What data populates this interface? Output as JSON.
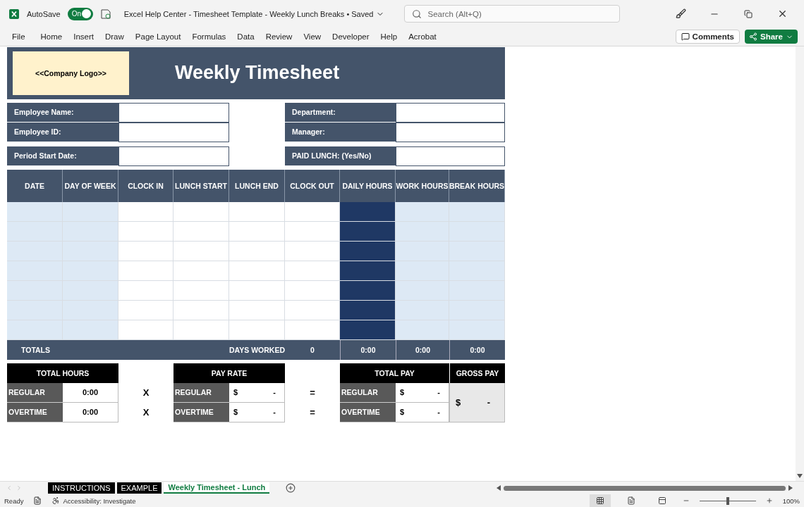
{
  "window": {
    "title": "Excel Help Center - Timesheet Template - Weekly Lunch Breaks • Saved",
    "autosave": {
      "label": "AutoSave",
      "on": true,
      "state_label": "On"
    },
    "search": {
      "placeholder": "Search (Alt+Q)"
    }
  },
  "menu": {
    "items": [
      {
        "label": "File"
      },
      {
        "label": "Home"
      },
      {
        "label": "Insert"
      },
      {
        "label": "Draw"
      },
      {
        "label": "Page Layout"
      },
      {
        "label": "Formulas"
      },
      {
        "label": "Data"
      },
      {
        "label": "Review"
      },
      {
        "label": "View"
      },
      {
        "label": "Developer"
      },
      {
        "label": "Help"
      },
      {
        "label": "Acrobat"
      }
    ],
    "comments": "Comments",
    "share": "Share"
  },
  "sheet": {
    "logo": "<<Company Logo>>",
    "title": "Weekly Timesheet",
    "info_left": [
      {
        "label": "Employee Name:"
      },
      {
        "label": "Employee ID:"
      },
      {
        "label": "Period Start Date:"
      }
    ],
    "info_right": [
      {
        "label": "Department:"
      },
      {
        "label": "Manager:"
      },
      {
        "label": "PAID LUNCH: (Yes/No)"
      }
    ],
    "columns": [
      "DATE",
      "DAY OF WEEK",
      "CLOCK IN",
      "LUNCH START",
      "LUNCH END",
      "CLOCK OUT",
      "DAILY HOURS",
      "WORK HOURS",
      "BREAK HOURS"
    ],
    "totals": {
      "label": "TOTALS",
      "days_worked_label": "DAYS WORKED",
      "days_worked": "0",
      "daily_hours": "0:00",
      "work_hours": "0:00",
      "break_hours": "0:00"
    },
    "total_hours": {
      "title": "TOTAL HOURS",
      "rows": [
        {
          "label": "REGULAR",
          "value": "0:00"
        },
        {
          "label": "OVERTIME",
          "value": "0:00"
        }
      ]
    },
    "operators": [
      "X",
      "X"
    ],
    "pay_rate": {
      "title": "PAY RATE",
      "rows": [
        {
          "label": "REGULAR",
          "currency": "$",
          "value": "-"
        },
        {
          "label": "OVERTIME",
          "currency": "$",
          "value": "-"
        }
      ]
    },
    "equals": [
      "=",
      "="
    ],
    "total_pay": {
      "title": "TOTAL PAY",
      "rows": [
        {
          "label": "REGULAR",
          "currency": "$",
          "value": "-"
        },
        {
          "label": "OVERTIME",
          "currency": "$",
          "value": "-"
        }
      ]
    },
    "gross_pay": {
      "title": "GROSS PAY",
      "currency": "$",
      "value": "-"
    }
  },
  "sheet_tabs": [
    {
      "label": "INSTRUCTIONS",
      "selected": false
    },
    {
      "label": "EXAMPLE",
      "selected": false
    },
    {
      "label": "Weekly Timesheet - Lunch",
      "selected": true
    }
  ],
  "status_bar": {
    "ready": "Ready",
    "accessibility": "Accessibility: Investigate",
    "views": [
      {
        "selected": true
      },
      {
        "selected": false
      },
      {
        "selected": false
      }
    ],
    "zoom": {
      "level": 0.5
    },
    "zoom_label": "100%"
  }
}
